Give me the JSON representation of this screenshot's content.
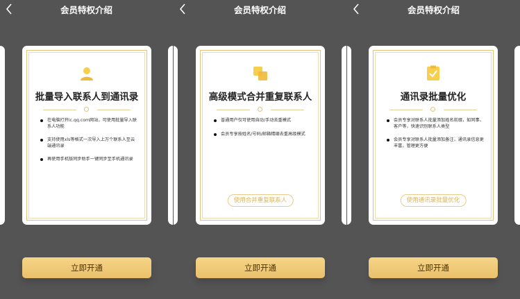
{
  "colors": {
    "background": "#545454",
    "gold": "#e2c37a",
    "cta": "#f2cc7d"
  },
  "panels": [
    {
      "nav_title": "会员特权介绍",
      "back_icon": "chevron-left-icon",
      "feature_icon": "person-icon",
      "card_title": "批量导入联系人到通讯录",
      "bullets": [
        "在电脑打开ic.qq.com网站，可使用批量导入联系人功能",
        "支持使用xls等格式一次导入上万个联系人至云端通讯录",
        "再使用手机版同步助手一键同步至手机通讯录"
      ],
      "card_action": "",
      "cta": "立即开通"
    },
    {
      "nav_title": "会员特权介绍",
      "back_icon": "chevron-left-icon",
      "feature_icon": "merge-icon",
      "card_title": "高级模式合并重复联系人",
      "bullets": [
        "普通用户仅可使用自动/手动去重模式",
        "会员专享按姓名/号码/邮箱精细去重高级模式"
      ],
      "card_action": "使用合并重复联系人",
      "cta": "立即开通"
    },
    {
      "nav_title": "会员特权介绍",
      "back_icon": "chevron-left-icon",
      "feature_icon": "checklist-icon",
      "card_title": "通讯录批量优化",
      "bullets": [
        "会员专享对联系人批量添加姓名前缀，如同事、客户等，快速识别联系人类型",
        "会员专享对联系人批量添加备注，通讯录信息更丰富，管理更方便"
      ],
      "card_action": "使用通讯录批量优化",
      "cta": "立即开通"
    }
  ]
}
